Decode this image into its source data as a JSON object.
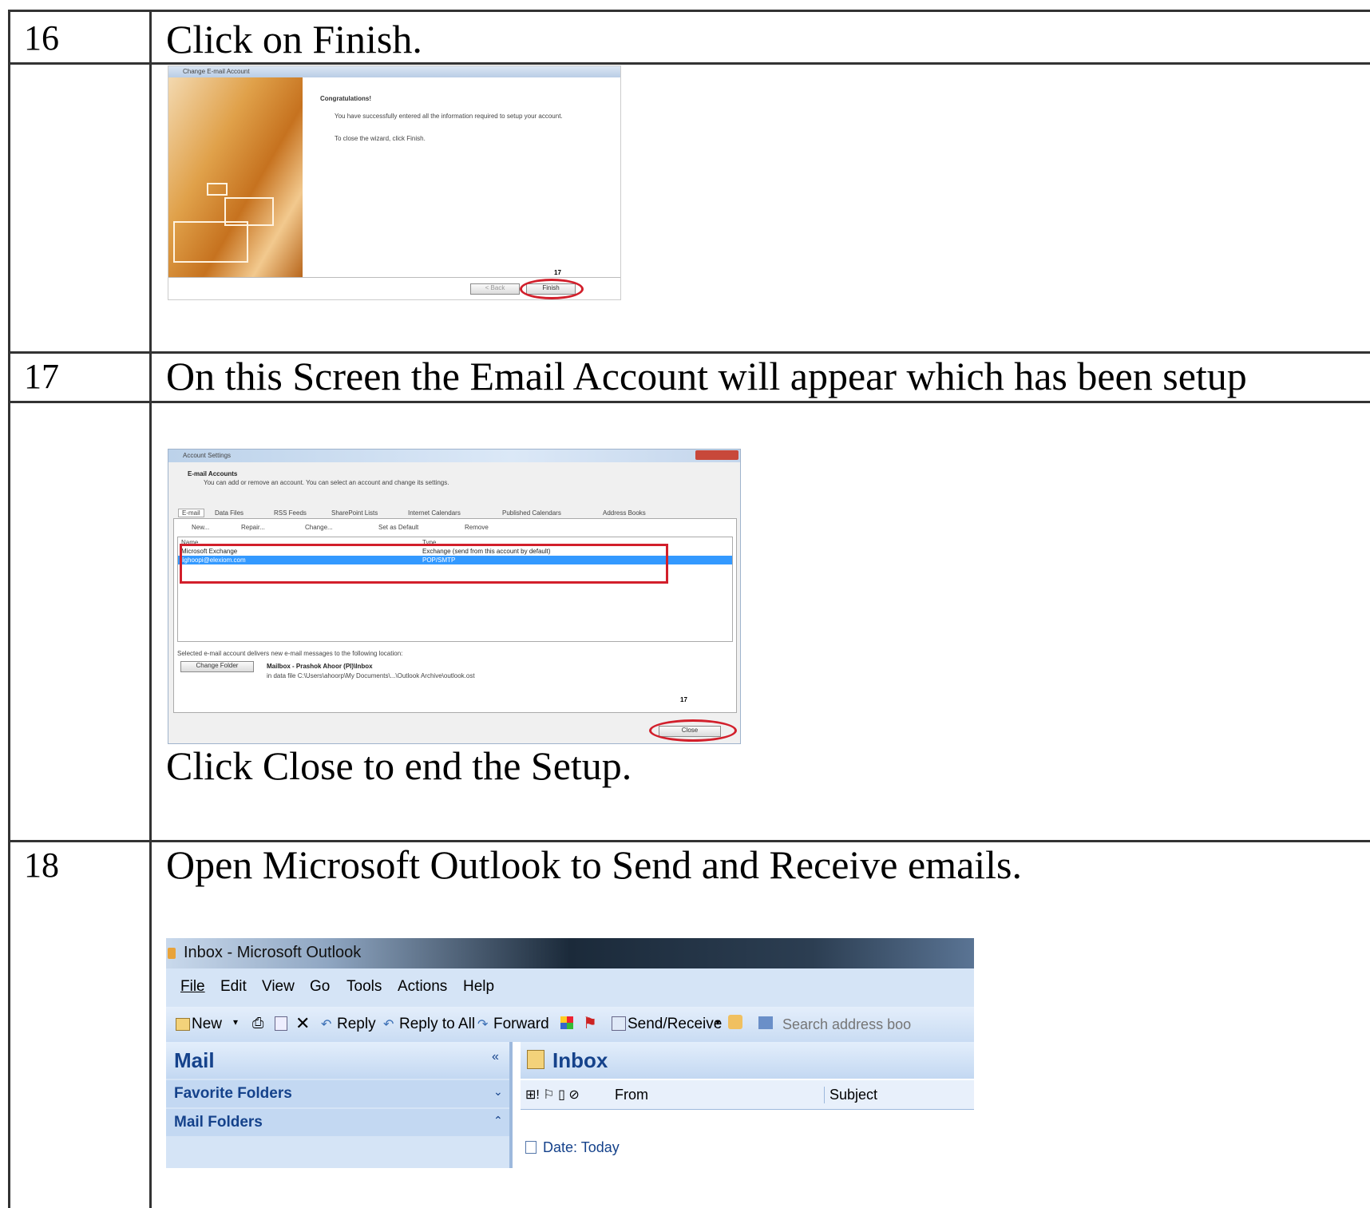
{
  "table": {
    "rows": [
      {
        "num": "16",
        "text": "Click on Finish."
      },
      {
        "num": "17",
        "text": "On this Screen the Email Account will appear which has been setup",
        "subtext": "Click Close to end the Setup."
      },
      {
        "num": "18",
        "text": "Open Microsoft Outlook to Send and Receive emails."
      }
    ]
  },
  "wizard": {
    "title": "Change E-mail Account",
    "heading": "Congratulations!",
    "message": "You have successfully entered all the information required to setup your account.",
    "instruction": "To close the wizard, click Finish.",
    "back_label": "< Back",
    "finish_label": "Finish",
    "annotation": "17"
  },
  "account_settings": {
    "title": "Account Settings",
    "heading": "E-mail Accounts",
    "subheading": "You can add or remove an account. You can select an account and change its settings.",
    "tabs": [
      "E-mail",
      "Data Files",
      "RSS Feeds",
      "SharePoint Lists",
      "Internet Calendars",
      "Published Calendars",
      "Address Books"
    ],
    "toolbar": [
      "New...",
      "Repair...",
      "Change...",
      "Set as Default",
      "Remove"
    ],
    "columns": [
      "Name",
      "Type"
    ],
    "accounts": [
      {
        "name": "Microsoft Exchange",
        "type": "Exchange (send from this account by default)"
      },
      {
        "name": "lighoopi@elexiom.com",
        "type": "POP/SMTP"
      }
    ],
    "delivery_text": "Selected e-mail account delivers new e-mail messages to the following location:",
    "change_folder_label": "Change Folder",
    "mailbox": "Mailbox - Prashok Ahoor (PI)\\Inbox",
    "data_file": "in data file C:\\Users\\ahoorp\\My Documents\\...\\Outlook Archive\\outlook.ost",
    "close_label": "Close",
    "annotation": "17"
  },
  "outlook": {
    "title": "Inbox - Microsoft Outlook",
    "menu": [
      "File",
      "Edit",
      "View",
      "Go",
      "Tools",
      "Actions",
      "Help"
    ],
    "toolbar": {
      "new": "New",
      "reply": "Reply",
      "reply_all": "Reply to All",
      "forward": "Forward",
      "send_receive": "Send/Receive",
      "search_placeholder": "Search address boo"
    },
    "nav": {
      "mail": "Mail",
      "favorite": "Favorite Folders",
      "folders": "Mail Folders"
    },
    "inbox": {
      "title": "Inbox",
      "from": "From",
      "subject": "Subject",
      "date": "Date: Today"
    }
  },
  "colors": {
    "annotation_red": "#d21f2b",
    "selection_blue": "#3399ff",
    "outlook_blue": "#c7dcf5"
  }
}
